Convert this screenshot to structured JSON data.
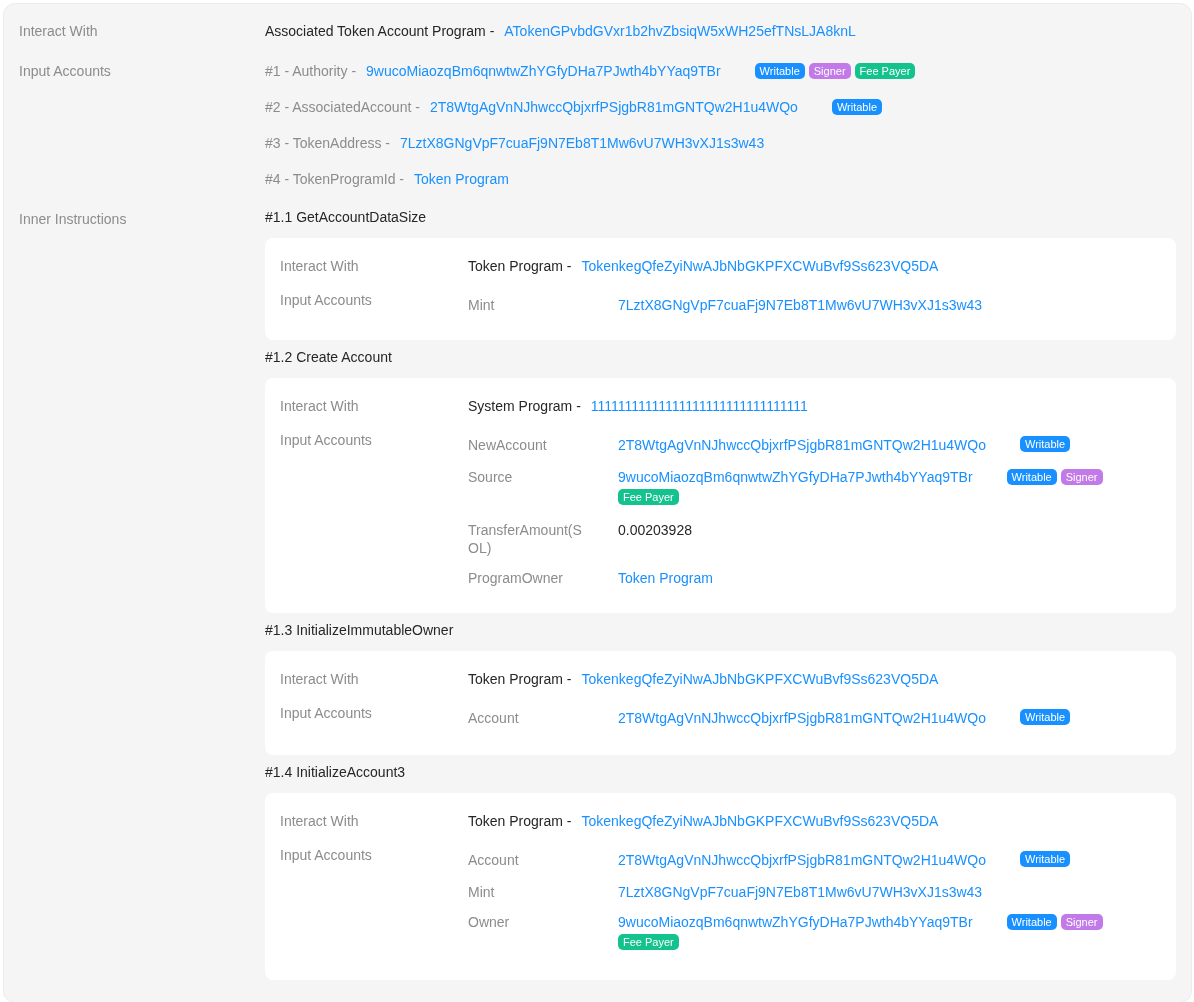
{
  "interact_with": {
    "label": "Interact With",
    "program": "Associated Token Account Program -",
    "address": "ATokenGPvbdGVxr1b2hvZbsiqW5xWH25efTNsLJA8knL"
  },
  "input_accounts": {
    "label": "Input Accounts",
    "items": [
      {
        "prefix": "#1 - Authority -",
        "value": "9wucoMiaozqBm6qnwtwZhYGfyDHa7PJwth4bYYaq9TBr",
        "tags": [
          {
            "label": "Writable",
            "color": "#1890ff"
          },
          {
            "label": "Signer",
            "color": "#c27ae8"
          },
          {
            "label": "Fee Payer",
            "color": "#14c28e"
          }
        ]
      },
      {
        "prefix": "#2 - AssociatedAccount -",
        "value": "2T8WtgAgVnNJhwccQbjxrfPSjgbR81mGNTQw2H1u4WQo",
        "tags": [
          {
            "label": "Writable",
            "color": "#1890ff"
          }
        ]
      },
      {
        "prefix": "#3 - TokenAddress -",
        "value": "7LztX8GNgVpF7cuaFj9N7Eb8T1Mw6vU7WH3vXJ1s3w43"
      },
      {
        "prefix": "#4 - TokenProgramId -",
        "value": "Token Program"
      }
    ]
  },
  "inner_instructions": {
    "label": "Inner Instructions",
    "items": [
      {
        "title": "#1.1 GetAccountDataSize",
        "interact_label": "Interact With",
        "program": "Token Program -",
        "address": "TokenkegQfeZyiNwAJbNbGKPFXCWuBvf9Ss623VQ5DA",
        "inputs_label": "Input Accounts",
        "accounts": [
          {
            "name": "Mint",
            "kind": "link",
            "value": "7LztX8GNgVpF7cuaFj9N7Eb8T1Mw6vU7WH3vXJ1s3w43"
          }
        ]
      },
      {
        "title": "#1.2 Create Account",
        "interact_label": "Interact With",
        "program": "System Program -",
        "address": "11111111111111111111111111111111",
        "inputs_label": "Input Accounts",
        "accounts": [
          {
            "name": "NewAccount",
            "kind": "link",
            "value": "2T8WtgAgVnNJhwccQbjxrfPSjgbR81mGNTQw2H1u4WQo",
            "tags": [
              {
                "label": "Writable",
                "color": "#1890ff"
              }
            ]
          },
          {
            "name": "Source",
            "kind": "link",
            "value": "9wucoMiaozqBm6qnwtwZhYGfyDHa7PJwth4bYYaq9TBr",
            "tags": [
              {
                "label": "Writable",
                "color": "#1890ff"
              },
              {
                "label": "Signer",
                "color": "#c27ae8"
              },
              {
                "label": "Fee Payer",
                "color": "#14c28e"
              }
            ]
          },
          {
            "name": "TransferAmount(SOL)",
            "kind": "text",
            "value": "0.00203928"
          },
          {
            "name": "ProgramOwner",
            "kind": "link",
            "value": "Token Program"
          }
        ]
      },
      {
        "title": "#1.3 InitializeImmutableOwner",
        "interact_label": "Interact With",
        "program": "Token Program -",
        "address": "TokenkegQfeZyiNwAJbNbGKPFXCWuBvf9Ss623VQ5DA",
        "inputs_label": "Input Accounts",
        "accounts": [
          {
            "name": "Account",
            "kind": "link",
            "value": "2T8WtgAgVnNJhwccQbjxrfPSjgbR81mGNTQw2H1u4WQo",
            "tags": [
              {
                "label": "Writable",
                "color": "#1890ff"
              }
            ]
          }
        ]
      },
      {
        "title": "#1.4 InitializeAccount3",
        "interact_label": "Interact With",
        "program": "Token Program -",
        "address": "TokenkegQfeZyiNwAJbNbGKPFXCWuBvf9Ss623VQ5DA",
        "inputs_label": "Input Accounts",
        "accounts": [
          {
            "name": "Account",
            "kind": "link",
            "value": "2T8WtgAgVnNJhwccQbjxrfPSjgbR81mGNTQw2H1u4WQo",
            "tags": [
              {
                "label": "Writable",
                "color": "#1890ff"
              }
            ]
          },
          {
            "name": "Mint",
            "kind": "link",
            "value": "7LztX8GNgVpF7cuaFj9N7Eb8T1Mw6vU7WH3vXJ1s3w43"
          },
          {
            "name": "Owner",
            "kind": "link",
            "value": "9wucoMiaozqBm6qnwtwZhYGfyDHa7PJwth4bYYaq9TBr",
            "tags": [
              {
                "label": "Writable",
                "color": "#1890ff"
              },
              {
                "label": "Signer",
                "color": "#c27ae8"
              },
              {
                "label": "Fee Payer",
                "color": "#14c28e"
              }
            ]
          }
        ]
      }
    ]
  }
}
